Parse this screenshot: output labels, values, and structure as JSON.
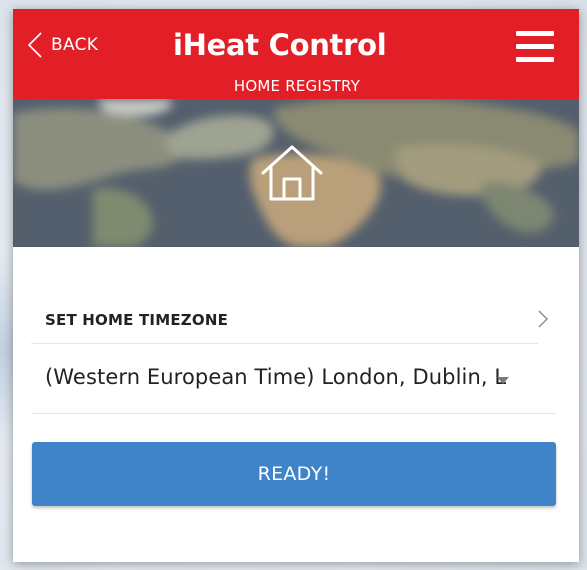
{
  "header": {
    "back_label": "BACK",
    "title": "iHeat Control",
    "subtitle": "HOME REGISTRY",
    "color": "#e21f26"
  },
  "hero": {
    "icon": "home-icon"
  },
  "timezone": {
    "section_label": "SET HOME TIMEZONE",
    "selected_value": "(Western European Time) London, Dublin, L"
  },
  "actions": {
    "ready_label": "READY!",
    "ready_color": "#3f83c8"
  }
}
